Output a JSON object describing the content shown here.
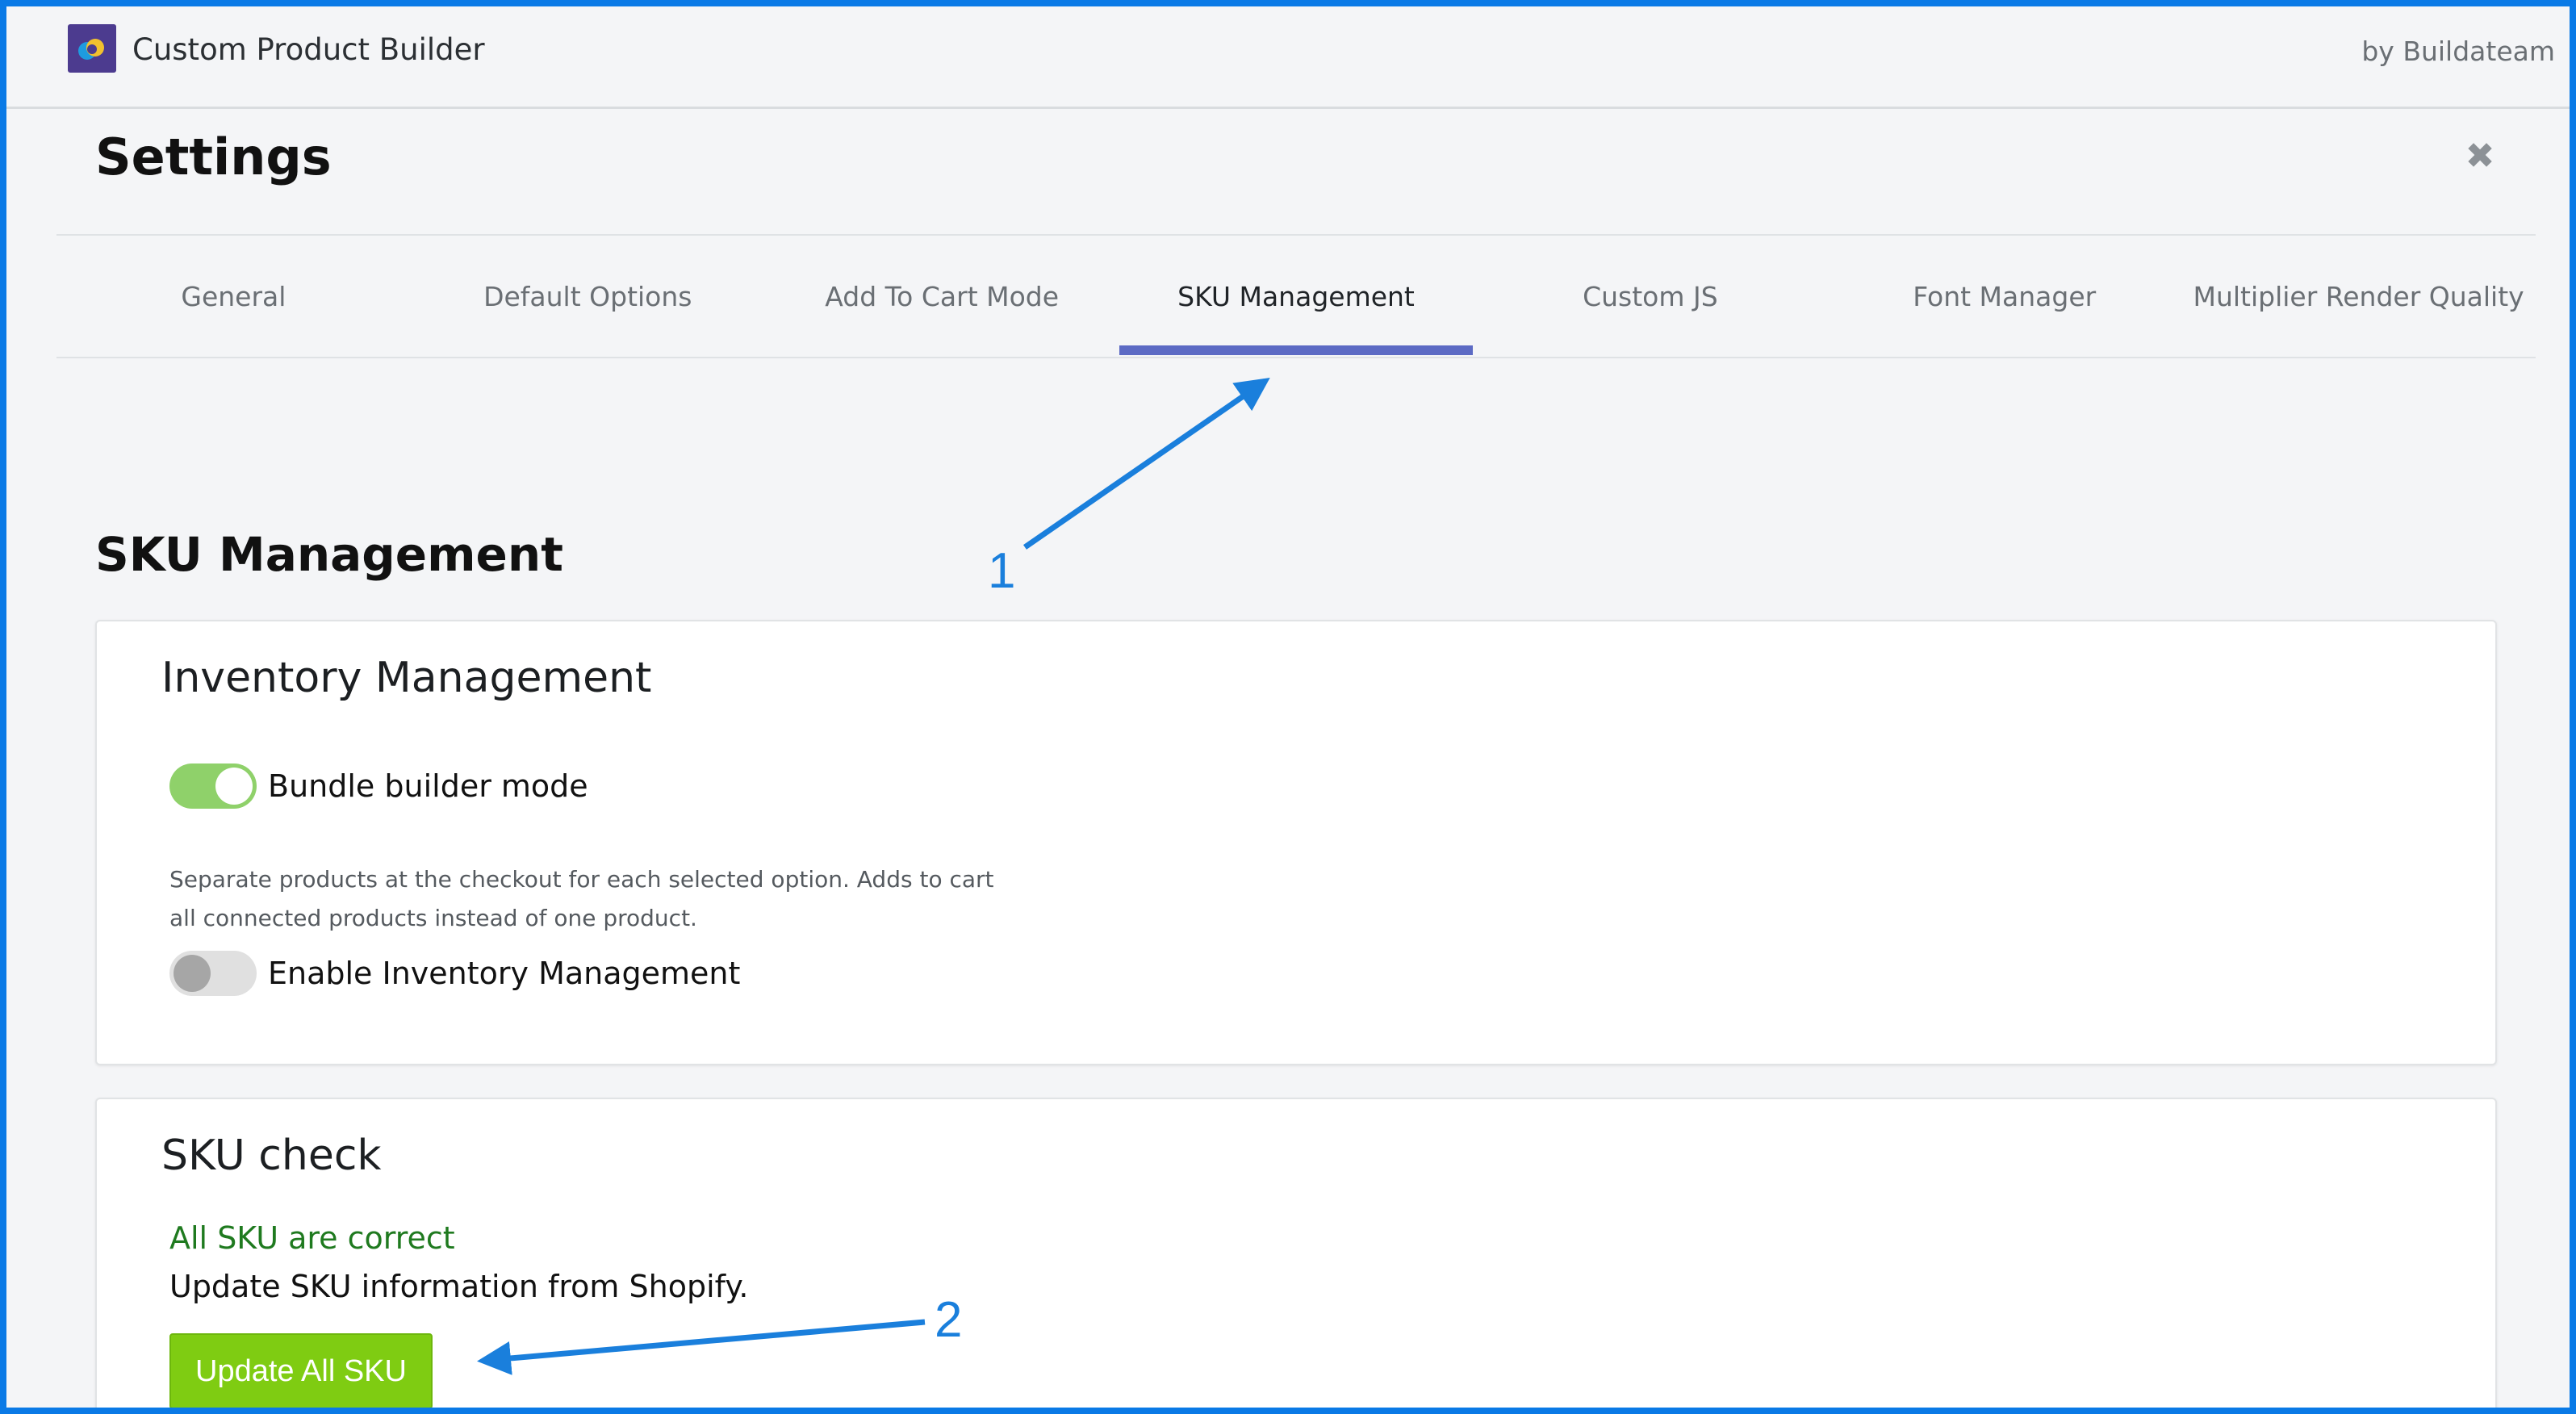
{
  "app": {
    "title": "Custom Product Builder",
    "by": "by Buildateam",
    "logo_icon": "app-logo-icon"
  },
  "page": {
    "title": "Settings",
    "close_icon": "close-icon"
  },
  "tabs": [
    {
      "label": "General",
      "active": false
    },
    {
      "label": "Default Options",
      "active": false
    },
    {
      "label": "Add To Cart Mode",
      "active": false
    },
    {
      "label": "SKU Management",
      "active": true
    },
    {
      "label": "Custom JS",
      "active": false
    },
    {
      "label": "Font Manager",
      "active": false
    },
    {
      "label": "Multiplier Render Quality",
      "active": false
    }
  ],
  "section": {
    "title": "SKU Management"
  },
  "inventory": {
    "title": "Inventory Management",
    "bundle_toggle": {
      "label": "Bundle builder mode",
      "on": true
    },
    "bundle_help": "Separate products at the checkout for each selected option. Adds to cart all connected products instead of one product.",
    "inventory_toggle": {
      "label": "Enable Inventory Management",
      "on": false
    }
  },
  "sku_check": {
    "title": "SKU check",
    "status": "All SKU are correct",
    "description": "Update SKU information from Shopify.",
    "button_label": "Update All SKU"
  },
  "annotations": {
    "marker_1": "1",
    "marker_2": "2"
  },
  "colors": {
    "accent": "#5c6ac4",
    "frame": "#0a7ae6",
    "annotation": "#1a7fdc",
    "toggle_on": "#8fd16a",
    "button": "#7fcc12",
    "success_text": "#1f7a1f"
  }
}
